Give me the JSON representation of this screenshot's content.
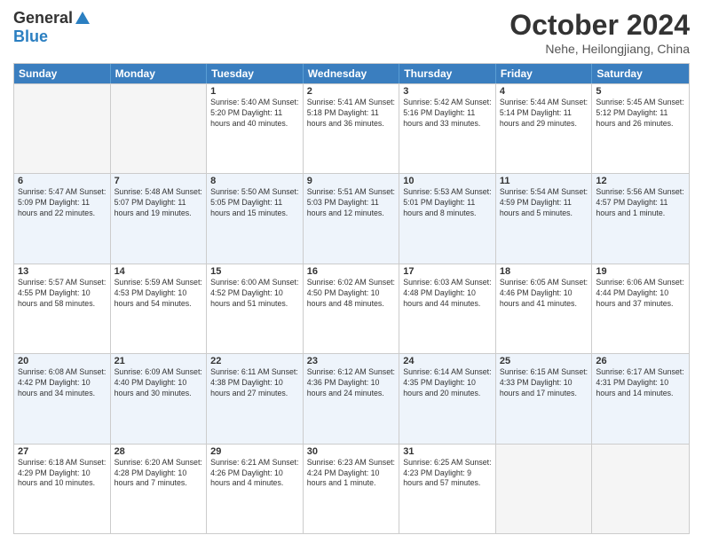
{
  "header": {
    "logo_general": "General",
    "logo_blue": "Blue",
    "month_title": "October 2024",
    "location": "Nehe, Heilongjiang, China"
  },
  "weekdays": [
    "Sunday",
    "Monday",
    "Tuesday",
    "Wednesday",
    "Thursday",
    "Friday",
    "Saturday"
  ],
  "rows": [
    [
      {
        "day": "",
        "info": ""
      },
      {
        "day": "",
        "info": ""
      },
      {
        "day": "1",
        "info": "Sunrise: 5:40 AM\nSunset: 5:20 PM\nDaylight: 11 hours and 40 minutes."
      },
      {
        "day": "2",
        "info": "Sunrise: 5:41 AM\nSunset: 5:18 PM\nDaylight: 11 hours and 36 minutes."
      },
      {
        "day": "3",
        "info": "Sunrise: 5:42 AM\nSunset: 5:16 PM\nDaylight: 11 hours and 33 minutes."
      },
      {
        "day": "4",
        "info": "Sunrise: 5:44 AM\nSunset: 5:14 PM\nDaylight: 11 hours and 29 minutes."
      },
      {
        "day": "5",
        "info": "Sunrise: 5:45 AM\nSunset: 5:12 PM\nDaylight: 11 hours and 26 minutes."
      }
    ],
    [
      {
        "day": "6",
        "info": "Sunrise: 5:47 AM\nSunset: 5:09 PM\nDaylight: 11 hours and 22 minutes."
      },
      {
        "day": "7",
        "info": "Sunrise: 5:48 AM\nSunset: 5:07 PM\nDaylight: 11 hours and 19 minutes."
      },
      {
        "day": "8",
        "info": "Sunrise: 5:50 AM\nSunset: 5:05 PM\nDaylight: 11 hours and 15 minutes."
      },
      {
        "day": "9",
        "info": "Sunrise: 5:51 AM\nSunset: 5:03 PM\nDaylight: 11 hours and 12 minutes."
      },
      {
        "day": "10",
        "info": "Sunrise: 5:53 AM\nSunset: 5:01 PM\nDaylight: 11 hours and 8 minutes."
      },
      {
        "day": "11",
        "info": "Sunrise: 5:54 AM\nSunset: 4:59 PM\nDaylight: 11 hours and 5 minutes."
      },
      {
        "day": "12",
        "info": "Sunrise: 5:56 AM\nSunset: 4:57 PM\nDaylight: 11 hours and 1 minute."
      }
    ],
    [
      {
        "day": "13",
        "info": "Sunrise: 5:57 AM\nSunset: 4:55 PM\nDaylight: 10 hours and 58 minutes."
      },
      {
        "day": "14",
        "info": "Sunrise: 5:59 AM\nSunset: 4:53 PM\nDaylight: 10 hours and 54 minutes."
      },
      {
        "day": "15",
        "info": "Sunrise: 6:00 AM\nSunset: 4:52 PM\nDaylight: 10 hours and 51 minutes."
      },
      {
        "day": "16",
        "info": "Sunrise: 6:02 AM\nSunset: 4:50 PM\nDaylight: 10 hours and 48 minutes."
      },
      {
        "day": "17",
        "info": "Sunrise: 6:03 AM\nSunset: 4:48 PM\nDaylight: 10 hours and 44 minutes."
      },
      {
        "day": "18",
        "info": "Sunrise: 6:05 AM\nSunset: 4:46 PM\nDaylight: 10 hours and 41 minutes."
      },
      {
        "day": "19",
        "info": "Sunrise: 6:06 AM\nSunset: 4:44 PM\nDaylight: 10 hours and 37 minutes."
      }
    ],
    [
      {
        "day": "20",
        "info": "Sunrise: 6:08 AM\nSunset: 4:42 PM\nDaylight: 10 hours and 34 minutes."
      },
      {
        "day": "21",
        "info": "Sunrise: 6:09 AM\nSunset: 4:40 PM\nDaylight: 10 hours and 30 minutes."
      },
      {
        "day": "22",
        "info": "Sunrise: 6:11 AM\nSunset: 4:38 PM\nDaylight: 10 hours and 27 minutes."
      },
      {
        "day": "23",
        "info": "Sunrise: 6:12 AM\nSunset: 4:36 PM\nDaylight: 10 hours and 24 minutes."
      },
      {
        "day": "24",
        "info": "Sunrise: 6:14 AM\nSunset: 4:35 PM\nDaylight: 10 hours and 20 minutes."
      },
      {
        "day": "25",
        "info": "Sunrise: 6:15 AM\nSunset: 4:33 PM\nDaylight: 10 hours and 17 minutes."
      },
      {
        "day": "26",
        "info": "Sunrise: 6:17 AM\nSunset: 4:31 PM\nDaylight: 10 hours and 14 minutes."
      }
    ],
    [
      {
        "day": "27",
        "info": "Sunrise: 6:18 AM\nSunset: 4:29 PM\nDaylight: 10 hours and 10 minutes."
      },
      {
        "day": "28",
        "info": "Sunrise: 6:20 AM\nSunset: 4:28 PM\nDaylight: 10 hours and 7 minutes."
      },
      {
        "day": "29",
        "info": "Sunrise: 6:21 AM\nSunset: 4:26 PM\nDaylight: 10 hours and 4 minutes."
      },
      {
        "day": "30",
        "info": "Sunrise: 6:23 AM\nSunset: 4:24 PM\nDaylight: 10 hours and 1 minute."
      },
      {
        "day": "31",
        "info": "Sunrise: 6:25 AM\nSunset: 4:23 PM\nDaylight: 9 hours and 57 minutes."
      },
      {
        "day": "",
        "info": ""
      },
      {
        "day": "",
        "info": ""
      }
    ]
  ]
}
